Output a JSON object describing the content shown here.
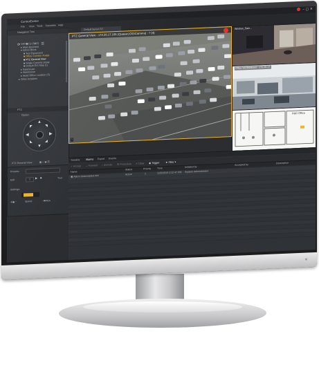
{
  "app": {
    "title": "ControlCenter",
    "menu": [
      "File",
      "View",
      "Tools",
      "Favorites",
      "Help"
    ]
  },
  "navigation": {
    "header": "Navigation Tree",
    "items": [
      {
        "label": "VMSB (1) (FW2)",
        "level": 0
      },
      {
        "label": "Main Business",
        "level": 1
      },
      {
        "label": "Admin Block",
        "level": 1
      },
      {
        "label": "Test Equipment",
        "level": 2
      },
      {
        "label": "Office Corridor Analyt",
        "level": 2,
        "highlight": true
      },
      {
        "label": "PTZ General View",
        "level": 2
      },
      {
        "label": "Single Camera Unpar",
        "level": 2
      },
      {
        "label": "Default GIS Map (1)",
        "level": 2
      },
      {
        "label": "Gatehouse",
        "level": 1
      },
      {
        "label": "Warehouse",
        "level": 1
      },
      {
        "label": "Head Office Location (S)",
        "level": 1
      },
      {
        "label": "Other Activities",
        "level": 0
      }
    ]
  },
  "ptz": {
    "header": "PTZ",
    "option_label": "Option",
    "camera_label": "PTZ General View :",
    "presets_label": "Presets:",
    "edit_label": "Edit",
    "settings_label": "Settings:",
    "iris_label": "Iris",
    "speed_label": "Speed",
    "focus_label": "Focus",
    "preset_value": "1",
    "tour_label": "Tour"
  },
  "layout": {
    "tab_label": "Default layout (V)",
    "main_video_title": "PTZ General View - 172.20.17.105 (Quasar1OG\\Camera) - 7 (4)",
    "cam2_title": "Window_Sam...",
    "cam3_title": "Office Workstations - 172.20.17.",
    "cam4_title": "R&D Office",
    "tile_number": "1"
  },
  "events": {
    "tabs": [
      "Timeline",
      "Alarms",
      "Export",
      "Events"
    ],
    "toolbar": [
      "Accept",
      "Forward",
      "Unmute",
      "Procedure",
      "Clear",
      "Trigger",
      "Filter"
    ],
    "columns": [
      "Name",
      "Status",
      "Priority",
      "Time",
      "Initiated by",
      "Accepted by",
      "Description"
    ],
    "rows": [
      {
        "name": "Alarm Unaccepted ###",
        "status": "Active",
        "priority": "1",
        "time": "12/5/2019 4:12:47 PM",
        "initiated": "System Administrator",
        "accepted": "",
        "description": ""
      }
    ]
  },
  "colors": {
    "accent": "#f0b429",
    "record": "#e8332b",
    "ui_background": "#2b2d30"
  }
}
